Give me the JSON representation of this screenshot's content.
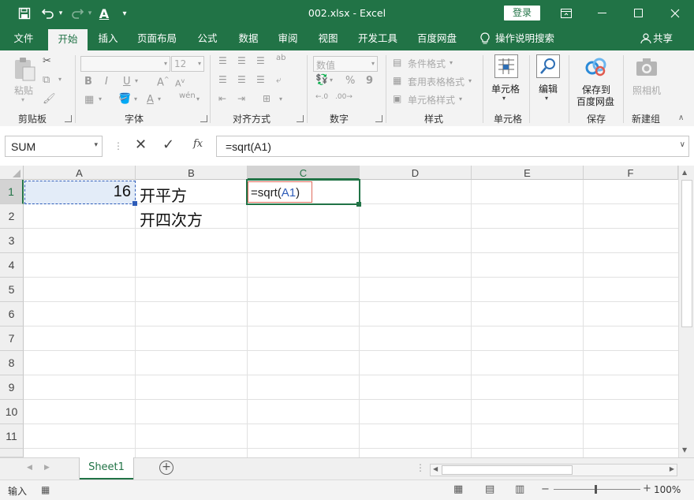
{
  "title_bar": {
    "document_title": "002.xlsx  -  Excel",
    "login_label": "登录",
    "quick_access": [
      "save-icon",
      "undo-icon",
      "redo-icon",
      "font-color-icon",
      "customize-icon"
    ],
    "window_controls": [
      "ribbon-display-icon",
      "minimize-icon",
      "maximize-icon",
      "close-icon"
    ]
  },
  "ribbon_tabs": [
    {
      "label": "文件"
    },
    {
      "label": "开始",
      "active": true
    },
    {
      "label": "插入"
    },
    {
      "label": "页面布局"
    },
    {
      "label": "公式"
    },
    {
      "label": "数据"
    },
    {
      "label": "审阅"
    },
    {
      "label": "视图"
    },
    {
      "label": "开发工具"
    },
    {
      "label": "百度网盘"
    }
  ],
  "tell_me": "操作说明搜索",
  "share": "共享",
  "ribbon": {
    "groups": {
      "clipboard": "剪贴板",
      "font": "字体",
      "alignment": "对齐方式",
      "number": "数字",
      "styles": "样式",
      "cells": "单元格",
      "editing": "编辑",
      "save": "保存",
      "new_group": "新建组"
    },
    "paste": "粘贴",
    "font_size": "12",
    "number_format": "数值",
    "conditional_format": "条件格式",
    "table_format": "套用表格格式",
    "cell_style": "单元格样式",
    "cells_button": "单元格",
    "edit_button": "编辑",
    "save_baidu_line1": "保存到",
    "save_baidu_line2": "百度网盘",
    "camera": "照相机",
    "bold": "B",
    "italic": "I",
    "underline": "U",
    "wen": "wén",
    "percent": "%",
    "comma": "9"
  },
  "formula_bar": {
    "name_box": "SUM",
    "fx": "fx",
    "formula": "=sqrt(A1)"
  },
  "grid": {
    "columns": [
      "A",
      "B",
      "C",
      "D",
      "E",
      "F"
    ],
    "selected_column": "C",
    "rows": [
      "1",
      "2",
      "3",
      "4",
      "5",
      "6",
      "7",
      "8",
      "9",
      "10",
      "11"
    ],
    "selected_row": "1",
    "cells": {
      "A1": "16",
      "B1": "开平方",
      "B2": "开四次方",
      "C1_prefix": "=sqrt(",
      "C1_ref": "A1",
      "C1_suffix": ")"
    },
    "ref_color": "#2e5cb8",
    "ref_box_color": "#e06b5c",
    "select_color": "#217346"
  },
  "sheet_tabs": [
    {
      "label": "Sheet1",
      "active": true
    }
  ],
  "status_bar": {
    "mode": "输入",
    "zoom": "100%"
  },
  "colors": {
    "brand": "#217346",
    "ribbon_bg": "#f3f3f3"
  }
}
